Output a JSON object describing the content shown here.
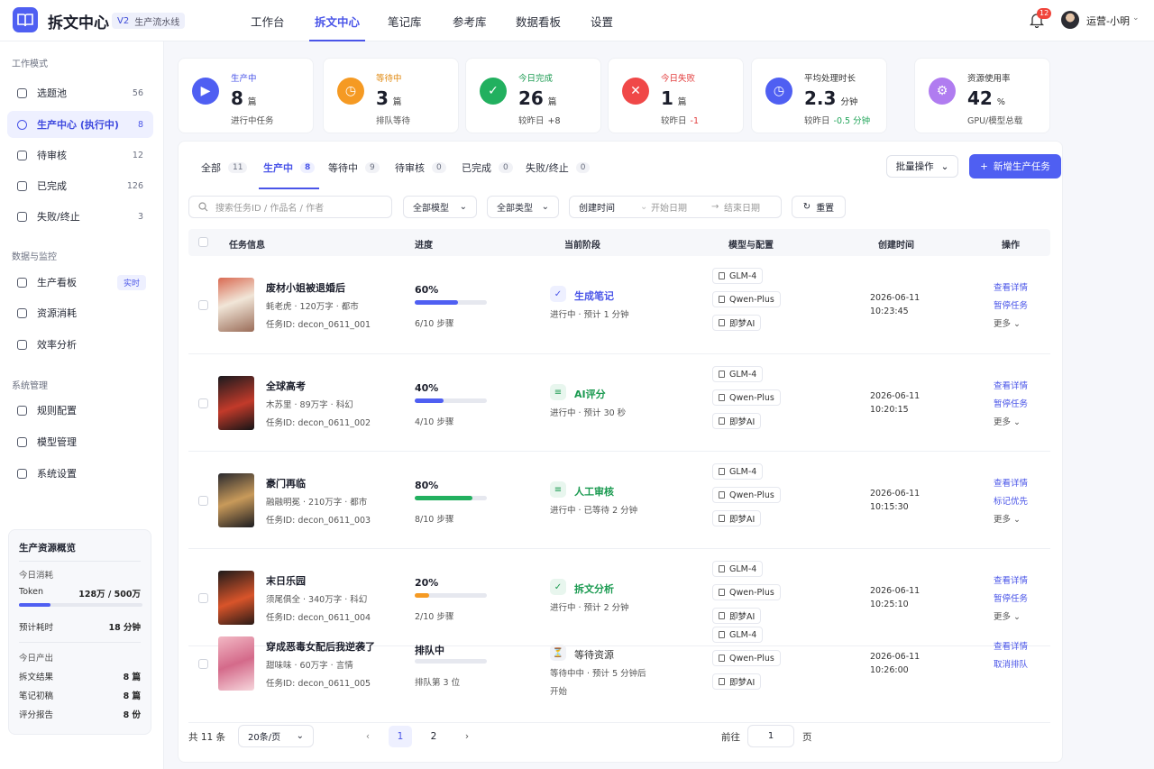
{
  "header": {
    "app_title": "拆文中心",
    "version": "V2",
    "subtitle": "生产流水线",
    "nav": [
      "工作台",
      "拆文中心",
      "笔记库",
      "参考库",
      "数据看板",
      "设置"
    ],
    "notifications": "12",
    "user": "运营-小明"
  },
  "sidebar": {
    "sec1": "工作模式",
    "sec2": "数据与监控",
    "sec3": "系统管理",
    "items": [
      {
        "label": "选题池",
        "count": "56",
        "icon": "inbox-icon"
      },
      {
        "label": "生产中心 (执行中)",
        "count": "8",
        "icon": "factory-icon"
      },
      {
        "label": "待审核",
        "count": "12",
        "icon": "clock-icon"
      },
      {
        "label": "已完成",
        "count": "126",
        "icon": "check-circle-icon"
      },
      {
        "label": "失败/终止",
        "count": "3",
        "icon": "x-circle-icon"
      },
      {
        "label": "生产看板",
        "tag": "实时",
        "icon": "chart-icon"
      },
      {
        "label": "资源消耗",
        "icon": "bars-icon"
      },
      {
        "label": "效率分析",
        "icon": "timer-icon"
      },
      {
        "label": "规则配置",
        "icon": "gear-icon"
      },
      {
        "label": "模型管理",
        "icon": "cube-icon"
      },
      {
        "label": "系统设置",
        "icon": "settings-icon"
      }
    ],
    "resource": {
      "title": "生产资源概览",
      "today_use": "今日消耗",
      "token_label": "Token",
      "token_value": "128万 / 500万",
      "token_ratio": 0.256,
      "eta_label": "预计耗时",
      "eta_value": "18 分钟",
      "today_output": "今日产出",
      "rows": [
        {
          "label": "拆文结果",
          "value": "8 篇"
        },
        {
          "label": "笔记初稿",
          "value": "8 篇"
        },
        {
          "label": "评分报告",
          "value": "8 份"
        }
      ]
    }
  },
  "stats": [
    {
      "label": "生产中",
      "value": "8",
      "unit": "篇",
      "sub": "进行中任务",
      "delta": "",
      "color": "#4f5ff2",
      "label_color": "#4a55e8",
      "delta_color": "",
      "icon": "play-icon",
      "glyph": "▶"
    },
    {
      "label": "等待中",
      "value": "3",
      "unit": "篇",
      "sub": "排队等待",
      "delta": "",
      "color": "#f59a23",
      "label_color": "#e08a12",
      "delta_color": "",
      "icon": "clock-icon",
      "glyph": "◷"
    },
    {
      "label": "今日完成",
      "value": "26",
      "unit": "篇",
      "sub": "较昨日",
      "delta": "+8",
      "color": "#22b05f",
      "label_color": "#1a9a50",
      "delta_color": "#444",
      "icon": "check-icon",
      "glyph": "✓"
    },
    {
      "label": "今日失败",
      "value": "1",
      "unit": "篇",
      "sub": "较昨日",
      "delta": "-1",
      "color": "#f04848",
      "label_color": "#e23c3c",
      "delta_color": "#e23c3c",
      "icon": "x-icon",
      "glyph": "✕"
    },
    {
      "label": "平均处理时长",
      "value": "2.3",
      "unit": "分钟",
      "sub": "较昨日",
      "delta": "-0.5 分钟",
      "color": "#4f5ff2",
      "label_color": "#333",
      "delta_color": "#22a55a",
      "icon": "stopwatch-icon",
      "glyph": "◷"
    },
    {
      "label": "资源使用率",
      "value": "42",
      "unit": "%",
      "sub": "GPU/模型总载",
      "delta": "",
      "color": "#b07cf0",
      "label_color": "#333",
      "delta_color": "",
      "icon": "chip-icon",
      "glyph": "⚙"
    }
  ],
  "tabs": [
    {
      "label": "全部",
      "count": "11"
    },
    {
      "label": "生产中",
      "count": "8"
    },
    {
      "label": "等待中",
      "count": "9"
    },
    {
      "label": "待审核",
      "count": "0"
    },
    {
      "label": "已完成",
      "count": "0"
    },
    {
      "label": "失败/终止",
      "count": "0"
    }
  ],
  "toolbar": {
    "batch": "批量操作",
    "add": "新增生产任务"
  },
  "filters": {
    "search_placeholder": "搜索任务ID / 作品名 / 作者",
    "model": "全部模型",
    "type": "全部类型",
    "time": "创建时间",
    "start": "开始日期",
    "end": "结束日期",
    "reset": "重置"
  },
  "table": {
    "headers": [
      "任务信息",
      "进度",
      "当前阶段",
      "模型与配置",
      "创建时间",
      "操作"
    ],
    "rows": [
      {
        "title": "废材小姐被退婚后",
        "meta": "蚝老虎 · 120万字 · 都市",
        "id": "任务ID:  decon_0611_001",
        "pct": "60%",
        "progress": 0.6,
        "bar_color": "#4f5ff2",
        "pct_color": "#1b1e2b",
        "steps": "6/10 步骤",
        "stage": "生成笔记",
        "stage_color": "#4a55e8",
        "stage_bg": "#eef0ff",
        "stage_glyph": "✓",
        "stage_icon": "note-stage-icon",
        "stage_sub": "进行中 · 预计 1 分钟",
        "models": [
          "GLM-4",
          "Qwen-Plus",
          "即梦AI"
        ],
        "date": "2026-06-11",
        "time": "10:23:45",
        "actions": [
          "查看详情",
          "暂停任务",
          "更多"
        ],
        "cover": "linear-gradient(160deg,#d96a52,#f1e6d8 45%,#9a6c58)"
      },
      {
        "title": "全球高考",
        "meta": "木苏里 · 89万字 · 科幻",
        "id": "任务ID:  decon_0611_002",
        "pct": "40%",
        "progress": 0.4,
        "bar_color": "#4f5ff2",
        "pct_color": "#1b1e2b",
        "steps": "4/10 步骤",
        "stage": "AI评分",
        "stage_color": "#1a9a50",
        "stage_bg": "#e8f6ee",
        "stage_glyph": "≡",
        "stage_icon": "score-stage-icon",
        "stage_sub": "进行中 · 预计 30 秒",
        "models": [
          "GLM-4",
          "Qwen-Plus",
          "即梦AI"
        ],
        "date": "2026-06-11",
        "time": "10:20:15",
        "actions": [
          "查看详情",
          "暂停任务",
          "更多"
        ],
        "cover": "linear-gradient(160deg,#1a1a1e,#c23a2a 55%,#141416)"
      },
      {
        "title": "豪门再临",
        "meta": "融融明冕 · 210万字 · 都市",
        "id": "任务ID:  decon_0611_003",
        "pct": "80%",
        "progress": 0.8,
        "bar_color": "#22b05f",
        "pct_color": "#1b1e2b",
        "steps": "8/10 步骤",
        "stage": "人工审核",
        "stage_color": "#1a9a50",
        "stage_bg": "#e8f6ee",
        "stage_glyph": "≡",
        "stage_icon": "review-stage-icon",
        "stage_sub": "进行中 · 已等待 2 分钟",
        "models": [
          "GLM-4",
          "Qwen-Plus",
          "即梦AI"
        ],
        "date": "2026-06-11",
        "time": "10:15:30",
        "actions": [
          "查看详情",
          "标记优先",
          "更多"
        ],
        "cover": "linear-gradient(160deg,#2a2a2e,#c89a5a 50%,#1c1c20)"
      },
      {
        "title": "末日乐园",
        "meta": "须尾俱全 · 340万字 · 科幻",
        "id": "任务ID:  decon_0611_004",
        "pct": "20%",
        "progress": 0.2,
        "bar_color": "#f59a23",
        "pct_color": "#1b1e2b",
        "steps": "2/10 步骤",
        "stage": "拆文分析",
        "stage_color": "#1a9a50",
        "stage_bg": "#e8f6ee",
        "stage_glyph": "✓",
        "stage_icon": "analysis-stage-icon",
        "stage_sub": "进行中 · 预计 2 分钟",
        "models": [
          "GLM-4",
          "Qwen-Plus",
          "即梦AI"
        ],
        "date": "2026-06-11",
        "time": "10:25:10",
        "actions": [
          "查看详情",
          "暂停任务",
          "更多"
        ],
        "cover": "linear-gradient(160deg,#1e1a1a,#d8542a 55%,#2a1a16)"
      },
      {
        "title": "穿成恶毒女配后我逆袭了",
        "meta": "甜味味 · 60万字 · 言情",
        "id": "任务ID:  decon_0611_005",
        "pct": "排队中",
        "progress": 0,
        "bar_color": "#dcdfe6",
        "pct_color": "#1b1e2b",
        "steps": "排队第 3 位",
        "stage": "等待资源",
        "stage_color": "#333",
        "stage_bg": "#f1f2f6",
        "stage_glyph": "⏳",
        "stage_icon": "waiting-stage-icon",
        "stage_sub": "等待中中 · 预计 5 分钟后开始",
        "models": [
          "GLM-4",
          "Qwen-Plus",
          "即梦AI"
        ],
        "date": "2026-06-11",
        "time": "10:26:00",
        "actions": [
          "查看详情",
          "取消排队"
        ],
        "cover": "linear-gradient(160deg,#f2b8c4,#d46a8a 50%,#f6d6dc)"
      }
    ]
  },
  "pagination": {
    "total": "共 11 条",
    "page_size": "20条/页",
    "pages": [
      "1",
      "2"
    ],
    "goto": "前往",
    "goto_value": "1",
    "page_unit": "页"
  }
}
